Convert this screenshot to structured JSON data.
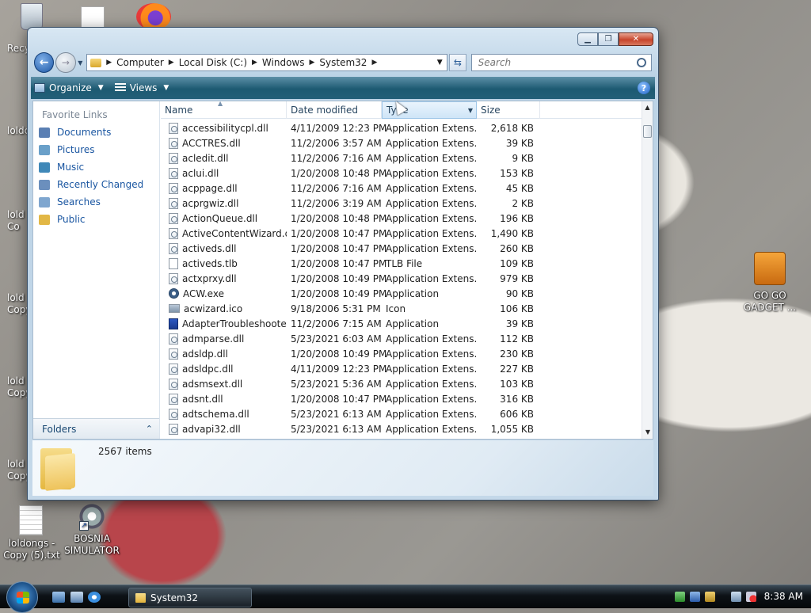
{
  "desktop": {
    "icons": [
      {
        "label": "GO GO GADGET ..."
      },
      {
        "label": "loldongs - Copy (5).txt"
      },
      {
        "label": "BOSNIA SIMULATOR"
      }
    ],
    "left_clips": [
      "Recy",
      "loldc",
      "lold\nCo",
      "lold\nCopy",
      "lold\nCopy",
      "lold\nCopy",
      "lold\nCopy"
    ]
  },
  "window": {
    "breadcrumb": [
      "Computer",
      "Local Disk (C:)",
      "Windows",
      "System32"
    ],
    "search_placeholder": "Search",
    "toolbar": {
      "organize": "Organize",
      "views": "Views"
    },
    "nav": {
      "favorite_links_title": "Favorite Links",
      "links": [
        {
          "label": "Documents",
          "color": "#5a7fb3"
        },
        {
          "label": "Pictures",
          "color": "#6aa0c9"
        },
        {
          "label": "Music",
          "color": "#3f88b8"
        },
        {
          "label": "Recently Changed",
          "color": "#6b8fbd"
        },
        {
          "label": "Searches",
          "color": "#7fa6cf"
        },
        {
          "label": "Public",
          "color": "#e2b745"
        }
      ],
      "folders_label": "Folders"
    },
    "columns": {
      "name": "Name",
      "date": "Date modified",
      "type": "Type",
      "size": "Size"
    },
    "files": [
      {
        "name": "accessibilitycpl.dll",
        "date": "4/11/2009 12:23 PM",
        "type": "Application Extens...",
        "size": "2,618 KB",
        "icon": "dll"
      },
      {
        "name": "ACCTRES.dll",
        "date": "11/2/2006 3:57 AM",
        "type": "Application Extens...",
        "size": "39 KB",
        "icon": "dll"
      },
      {
        "name": "acledit.dll",
        "date": "11/2/2006 7:16 AM",
        "type": "Application Extens...",
        "size": "9 KB",
        "icon": "dll"
      },
      {
        "name": "aclui.dll",
        "date": "1/20/2008 10:48 PM",
        "type": "Application Extens...",
        "size": "153 KB",
        "icon": "dll"
      },
      {
        "name": "acppage.dll",
        "date": "11/2/2006 7:16 AM",
        "type": "Application Extens...",
        "size": "45 KB",
        "icon": "dll"
      },
      {
        "name": "acprgwiz.dll",
        "date": "11/2/2006 3:19 AM",
        "type": "Application Extens...",
        "size": "2 KB",
        "icon": "dll"
      },
      {
        "name": "ActionQueue.dll",
        "date": "1/20/2008 10:48 PM",
        "type": "Application Extens...",
        "size": "196 KB",
        "icon": "dll"
      },
      {
        "name": "ActiveContentWizard.dll",
        "date": "1/20/2008 10:47 PM",
        "type": "Application Extens...",
        "size": "1,490 KB",
        "icon": "dll"
      },
      {
        "name": "activeds.dll",
        "date": "1/20/2008 10:47 PM",
        "type": "Application Extens...",
        "size": "260 KB",
        "icon": "dll"
      },
      {
        "name": "activeds.tlb",
        "date": "1/20/2008 10:47 PM",
        "type": "TLB File",
        "size": "109 KB",
        "icon": "tlb"
      },
      {
        "name": "actxprxy.dll",
        "date": "1/20/2008 10:49 PM",
        "type": "Application Extens...",
        "size": "979 KB",
        "icon": "dll"
      },
      {
        "name": "ACW.exe",
        "date": "1/20/2008 10:49 PM",
        "type": "Application",
        "size": "90 KB",
        "icon": "exe"
      },
      {
        "name": "acwizard.ico",
        "date": "9/18/2006 5:31 PM",
        "type": "Icon",
        "size": "106 KB",
        "icon": "ico"
      },
      {
        "name": "AdapterTroubleshoote...",
        "date": "11/2/2006 7:15 AM",
        "type": "Application",
        "size": "39 KB",
        "icon": "app"
      },
      {
        "name": "admparse.dll",
        "date": "5/23/2021 6:03 AM",
        "type": "Application Extens...",
        "size": "112 KB",
        "icon": "dll"
      },
      {
        "name": "adsldp.dll",
        "date": "1/20/2008 10:49 PM",
        "type": "Application Extens...",
        "size": "230 KB",
        "icon": "dll"
      },
      {
        "name": "adsldpc.dll",
        "date": "4/11/2009 12:23 PM",
        "type": "Application Extens...",
        "size": "227 KB",
        "icon": "dll"
      },
      {
        "name": "adsmsext.dll",
        "date": "5/23/2021 5:36 AM",
        "type": "Application Extens...",
        "size": "103 KB",
        "icon": "dll"
      },
      {
        "name": "adsnt.dll",
        "date": "1/20/2008 10:47 PM",
        "type": "Application Extens...",
        "size": "316 KB",
        "icon": "dll"
      },
      {
        "name": "adtschema.dll",
        "date": "5/23/2021 6:13 AM",
        "type": "Application Extens...",
        "size": "606 KB",
        "icon": "dll"
      },
      {
        "name": "advapi32.dll",
        "date": "5/23/2021 6:13 AM",
        "type": "Application Extens...",
        "size": "1,055 KB",
        "icon": "dll"
      }
    ],
    "item_count": "2567 items"
  },
  "taskbar": {
    "task_label": "System32",
    "clock": "8:38 AM"
  }
}
